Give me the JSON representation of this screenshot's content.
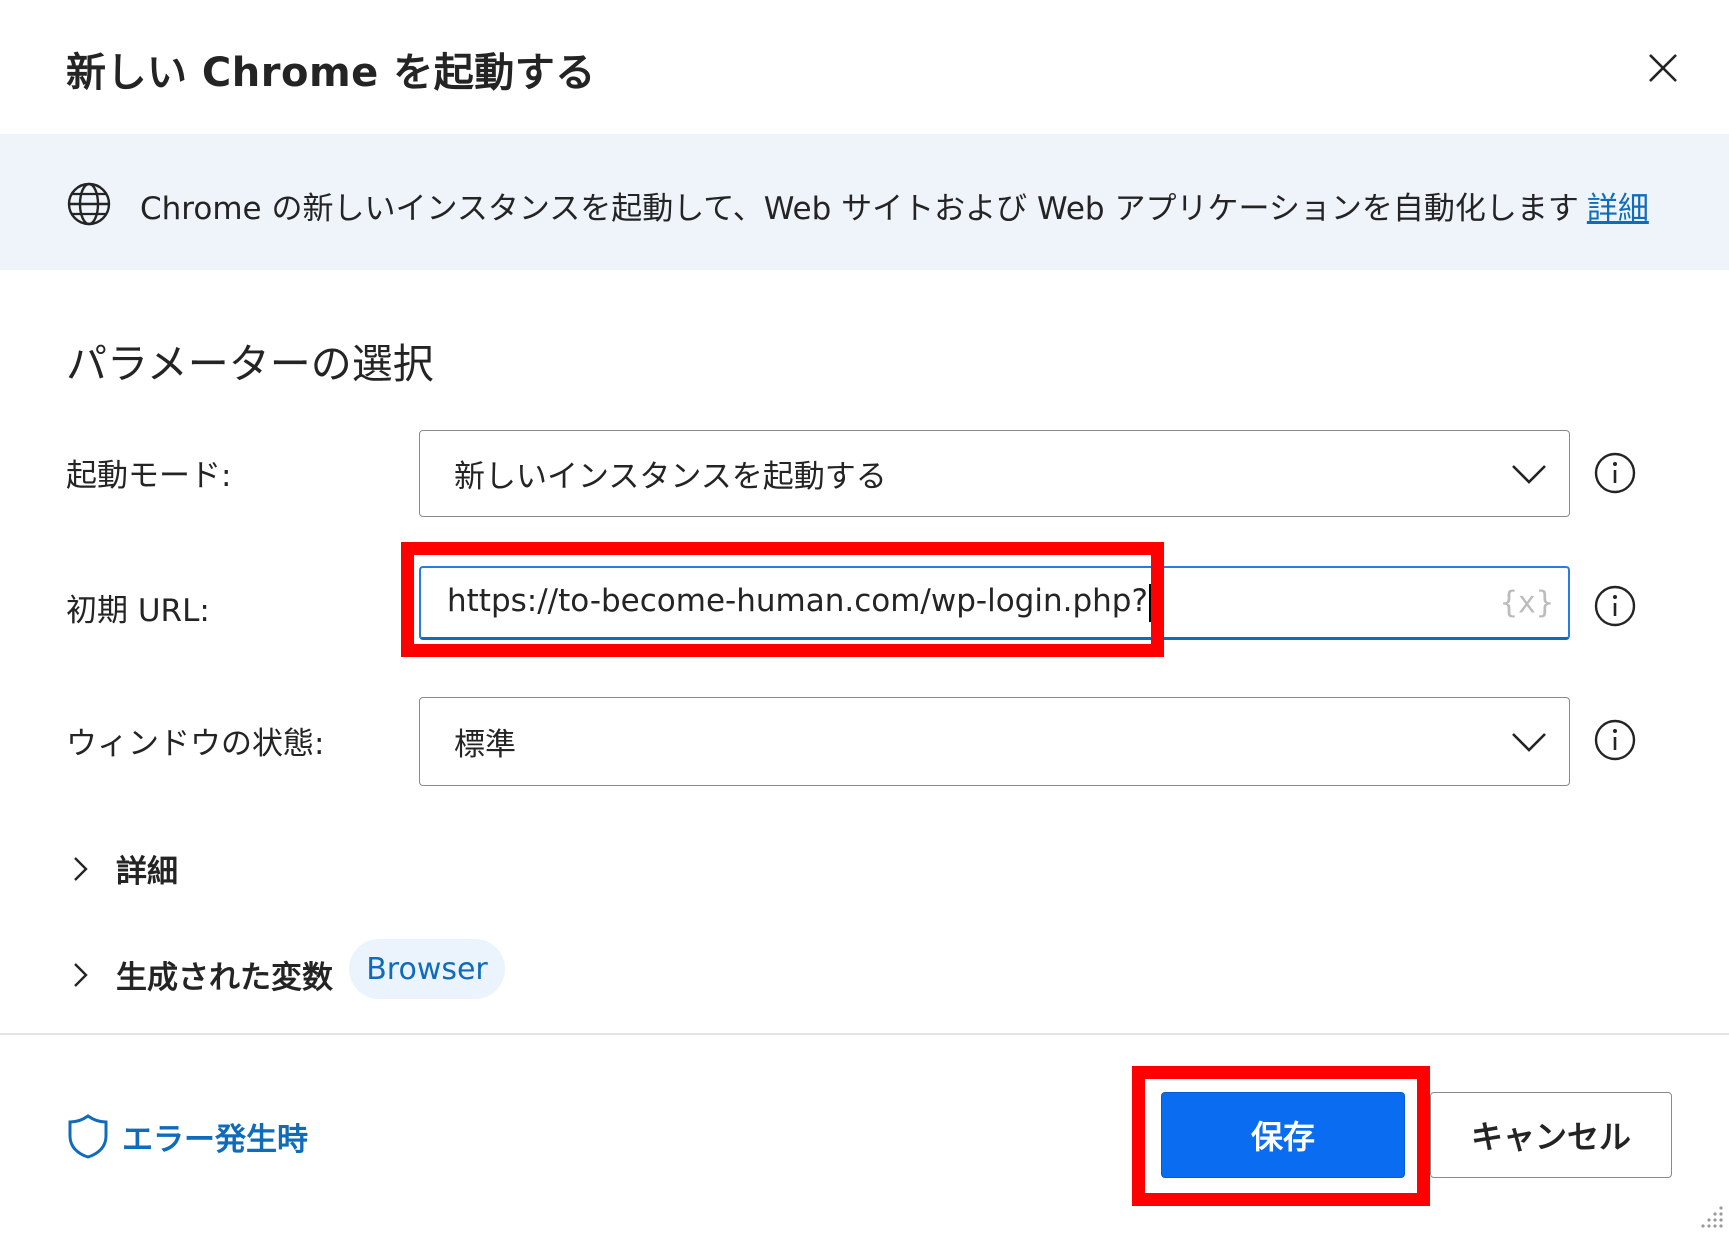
{
  "dialog": {
    "title": "新しい Chrome を起動する",
    "close_label": "×"
  },
  "banner": {
    "text": "Chrome の新しいインスタンスを起動して、Web サイトおよび Web アプリケーションを自動化します",
    "link": "詳細"
  },
  "section": {
    "title": "パラメーターの選択"
  },
  "fields": {
    "launch_mode": {
      "label": "起動モード:",
      "value": "新しいインスタンスを起動する"
    },
    "initial_url": {
      "label": "初期 URL:",
      "value": "https://to-become-human.com/wp-login.php?",
      "variable_button": "{x}"
    },
    "window_state": {
      "label": "ウィンドウの状態:",
      "value": "標準"
    }
  },
  "expanders": {
    "advanced": "詳細",
    "variables": "生成された変数",
    "variable_pill": "Browser"
  },
  "footer": {
    "on_error": "エラー発生時",
    "save": "保存",
    "cancel": "キャンセル"
  },
  "colors": {
    "accent": "#0f6cbd",
    "primary_button": "#0a6cf0",
    "banner_bg": "#eff4fb",
    "highlight": "#ff0000"
  },
  "icons": [
    "close-icon",
    "globe-icon",
    "chevron-down-icon",
    "info-icon",
    "chevron-right-icon",
    "shield-icon",
    "resize-grip-icon"
  ]
}
